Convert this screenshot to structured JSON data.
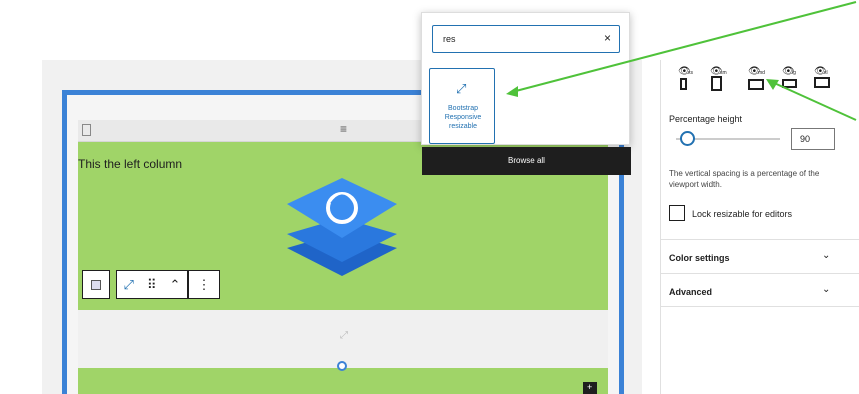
{
  "search": {
    "value": "res",
    "clear_glyph": "×"
  },
  "result": {
    "label_line1": "Bootstrap",
    "label_line2": "Responsive",
    "label_line3": "resizable",
    "icon": "diagonal-arrows-icon"
  },
  "browse_all": "Browse all",
  "editor": {
    "column_text": "This the left column",
    "corner_glyph": "+"
  },
  "toolbar": {
    "drag_glyph": "⠿",
    "updown_glyph": "⌃",
    "more_glyph": "⋮"
  },
  "sidebar": {
    "devices": [
      {
        "icon": "mobile-icon",
        "suffix": "xs"
      },
      {
        "icon": "tablet-icon",
        "suffix": "sm"
      },
      {
        "icon": "tablet-landscape-icon",
        "suffix": "md"
      },
      {
        "icon": "laptop-icon",
        "suffix": "lg"
      },
      {
        "icon": "desktop-icon",
        "suffix": "xl"
      }
    ],
    "percentage_label": "Percentage height",
    "percentage_value": "90",
    "help_text": "The vertical spacing is a percentage of the viewport width.",
    "lock_label": "Lock resizable for editors",
    "color_settings": "Color settings",
    "advanced": "Advanced",
    "chevron": "⌄"
  },
  "colors": {
    "accent": "#3b82d6",
    "green": "#a0d468",
    "arrow": "#4fc23a"
  }
}
